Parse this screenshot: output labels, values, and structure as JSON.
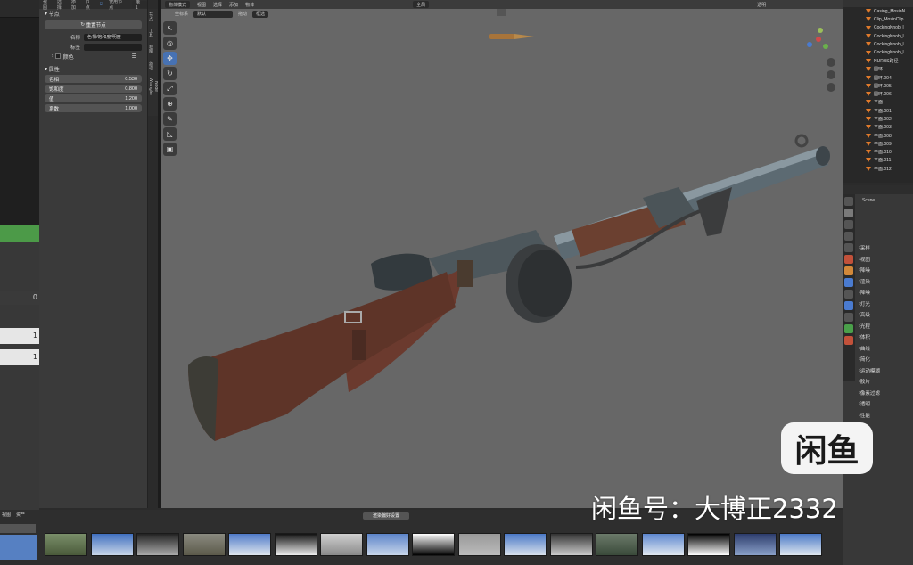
{
  "left_panel": {
    "menu": [
      "视图",
      "选择",
      "添加",
      "节点"
    ],
    "use_nodes_label": "使用节点",
    "slot": "槽 1",
    "left_values": [
      "0",
      "1",
      "1"
    ]
  },
  "node_panel": {
    "section_node": "节点",
    "reset_button": "重置节点",
    "name_label": "名称",
    "name_value": "色相/饱和度/明度",
    "label_label": "标签",
    "label_value": "",
    "color_label": "颜色",
    "props_section": "属性",
    "fields": [
      {
        "label": "色相",
        "value": "0.530"
      },
      {
        "label": "饱和度",
        "value": "0.800"
      },
      {
        "label": "值",
        "value": "1.200"
      },
      {
        "label": "系数",
        "value": "1.000"
      }
    ]
  },
  "side_tabs": [
    "节点",
    "工具",
    "视图",
    "选项",
    "Node Wrangler"
  ],
  "viewport": {
    "menu": [
      "物体模式",
      "视图",
      "选择",
      "添加",
      "物体"
    ],
    "coord_label": "坐标系",
    "coord_value": "默认",
    "drag_label": "拖动",
    "drag_value": "框选",
    "global_label": "全局",
    "shading_label": "透明"
  },
  "outliner": {
    "items": [
      {
        "name": "Casing_MosinN",
        "color": "orange"
      },
      {
        "name": "Clip_MosinClip",
        "color": "orange"
      },
      {
        "name": "CockingKnob_l",
        "color": "orange"
      },
      {
        "name": "CockingKnob_l",
        "color": "orange"
      },
      {
        "name": "CockingKnob_l",
        "color": "orange"
      },
      {
        "name": "CockingKnob_l",
        "color": "orange"
      },
      {
        "name": "NURBS路径",
        "color": "orange"
      },
      {
        "name": "圆环",
        "color": "orange"
      },
      {
        "name": "圆环.004",
        "color": "orange"
      },
      {
        "name": "圆环.005",
        "color": "orange"
      },
      {
        "name": "圆环.006",
        "color": "orange"
      },
      {
        "name": "平面",
        "color": "orange"
      },
      {
        "name": "平面.001",
        "color": "orange"
      },
      {
        "name": "平面.002",
        "color": "orange"
      },
      {
        "name": "平面.003",
        "color": "orange"
      },
      {
        "name": "平面.008",
        "color": "orange"
      },
      {
        "name": "平面.009",
        "color": "orange"
      },
      {
        "name": "平面.010",
        "color": "orange"
      },
      {
        "name": "平面.011",
        "color": "orange"
      },
      {
        "name": "平面.012",
        "color": "orange"
      }
    ]
  },
  "properties": {
    "scene": "Scene",
    "rows": [
      "采样",
      "视图",
      "降噪",
      "渲染",
      "降噪",
      "灯光",
      "高级",
      "光程",
      "体积",
      "曲线",
      "简化",
      "运动模糊",
      "胶片",
      "像素过滤",
      "透明",
      "性能"
    ]
  },
  "asset_bar": {
    "menu": [
      "视图",
      "资产"
    ],
    "title": "渲染偏好设置"
  },
  "watermark": {
    "logo": "闲鱼",
    "text": "闲鱼号：大博正2332"
  }
}
